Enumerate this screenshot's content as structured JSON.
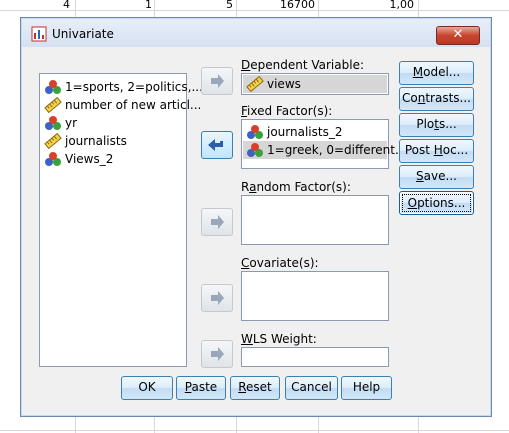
{
  "spreadsheet": {
    "top_row": [
      "4",
      "1",
      "5",
      "16700",
      "1,00"
    ]
  },
  "dialog": {
    "title": "Univariate",
    "close_label": "✕",
    "source_variables": [
      {
        "label": "1=sports, 2=politics,...",
        "icon": "nominal-icon"
      },
      {
        "label": "number of new articl...",
        "icon": "scale-icon"
      },
      {
        "label": "yr",
        "icon": "nominal-icon"
      },
      {
        "label": "journalists",
        "icon": "scale-icon"
      },
      {
        "label": "Views_2",
        "icon": "nominal-icon"
      }
    ],
    "dependent_variable": {
      "label_pre": "",
      "label_u": "D",
      "label_post": "ependent Variable:",
      "value": "views",
      "icon": "scale-icon"
    },
    "fixed_factors": {
      "label_pre": "",
      "label_u": "F",
      "label_post": "ixed Factor(s):",
      "items": [
        {
          "label": "journalists_2",
          "icon": "nominal-icon",
          "selected": false
        },
        {
          "label": "1=greek, 0=different...",
          "icon": "nominal-icon",
          "selected": true
        }
      ]
    },
    "random_factors": {
      "label_pre": "R",
      "label_u": "a",
      "label_post": "ndom Factor(s):"
    },
    "covariates": {
      "label_pre": "",
      "label_u": "C",
      "label_post": "ovariate(s):"
    },
    "wls_weight": {
      "label_pre": "",
      "label_u": "W",
      "label_post": "LS Weight:"
    },
    "side_buttons": {
      "model": {
        "pre": "",
        "u": "M",
        "post": "odel..."
      },
      "contrasts": {
        "pre": "Co",
        "u": "n",
        "post": "trasts..."
      },
      "plots": {
        "pre": "Plo",
        "u": "t",
        "post": "s..."
      },
      "posthoc": {
        "pre": "Post ",
        "u": "H",
        "post": "oc..."
      },
      "save": {
        "pre": "",
        "u": "S",
        "post": "ave..."
      },
      "options": {
        "pre": "",
        "u": "O",
        "post": "ptions..."
      }
    },
    "bottom_buttons": {
      "ok": {
        "pre": "OK",
        "u": "",
        "post": ""
      },
      "paste": {
        "pre": "",
        "u": "P",
        "post": "aste"
      },
      "reset": {
        "pre": "",
        "u": "R",
        "post": "eset"
      },
      "cancel": {
        "pre": "Cancel",
        "u": "",
        "post": ""
      },
      "help": {
        "pre": "Help",
        "u": "",
        "post": ""
      }
    }
  }
}
